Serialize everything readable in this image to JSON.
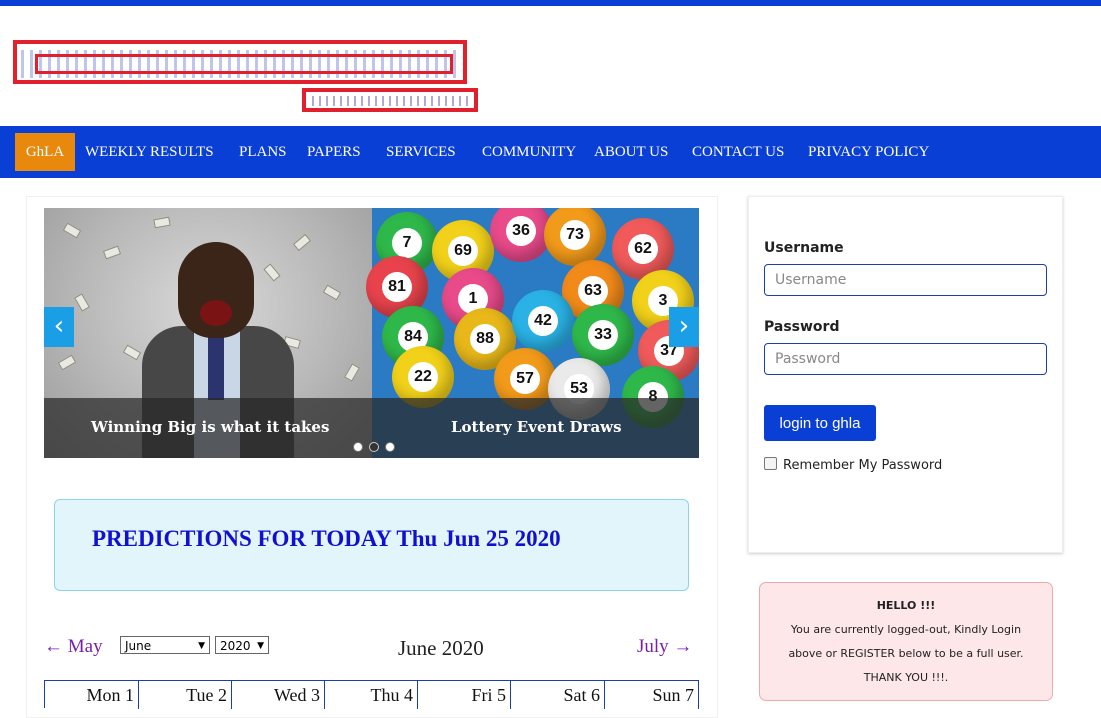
{
  "nav": {
    "home": "GhLA",
    "items": [
      "WEEKLY RESULTS",
      "PLANS",
      "PAPERS",
      "SERVICES",
      "COMMUNITY",
      "ABOUT US",
      "CONTACT US",
      "PRIVACY POLICY"
    ]
  },
  "slider": {
    "captions": [
      "Winning Big is what it takes",
      "Lottery Event Draws"
    ],
    "prev_icon": "chevron-left-icon",
    "next_icon": "chevron-right-icon",
    "slide_count": 3,
    "ball_numbers": [
      "7",
      "69",
      "36",
      "73",
      "62",
      "81",
      "1",
      "63",
      "3",
      "84",
      "88",
      "42",
      "33",
      "37",
      "22",
      "57",
      "53",
      "8"
    ]
  },
  "predictions": {
    "title": "PREDICTIONS FOR TODAY Thu Jun 25 2020"
  },
  "calendar": {
    "prev": "← May",
    "next": "July →",
    "month_select": "June",
    "year_select": "2020",
    "title": "June 2020",
    "days": [
      "Mon 1",
      "Tue 2",
      "Wed 3",
      "Thu 4",
      "Fri 5",
      "Sat 6",
      "Sun 7"
    ]
  },
  "login": {
    "username_label": "Username",
    "username_placeholder": "Username",
    "password_label": "Password",
    "password_placeholder": "Password",
    "button": "login to ghla",
    "remember": "Remember My Password"
  },
  "notice": {
    "heading": "HELLO !!!",
    "lines": [
      "You are currently logged-out, Kindly Login",
      "above or REGISTER below to be a full user.",
      "THANK YOU !!!."
    ]
  },
  "colors": {
    "brand_blue": "#0a3fd6",
    "home_orange": "#e8890e",
    "prediction_text": "#1010d0",
    "calendar_link": "#7a1fa8"
  }
}
